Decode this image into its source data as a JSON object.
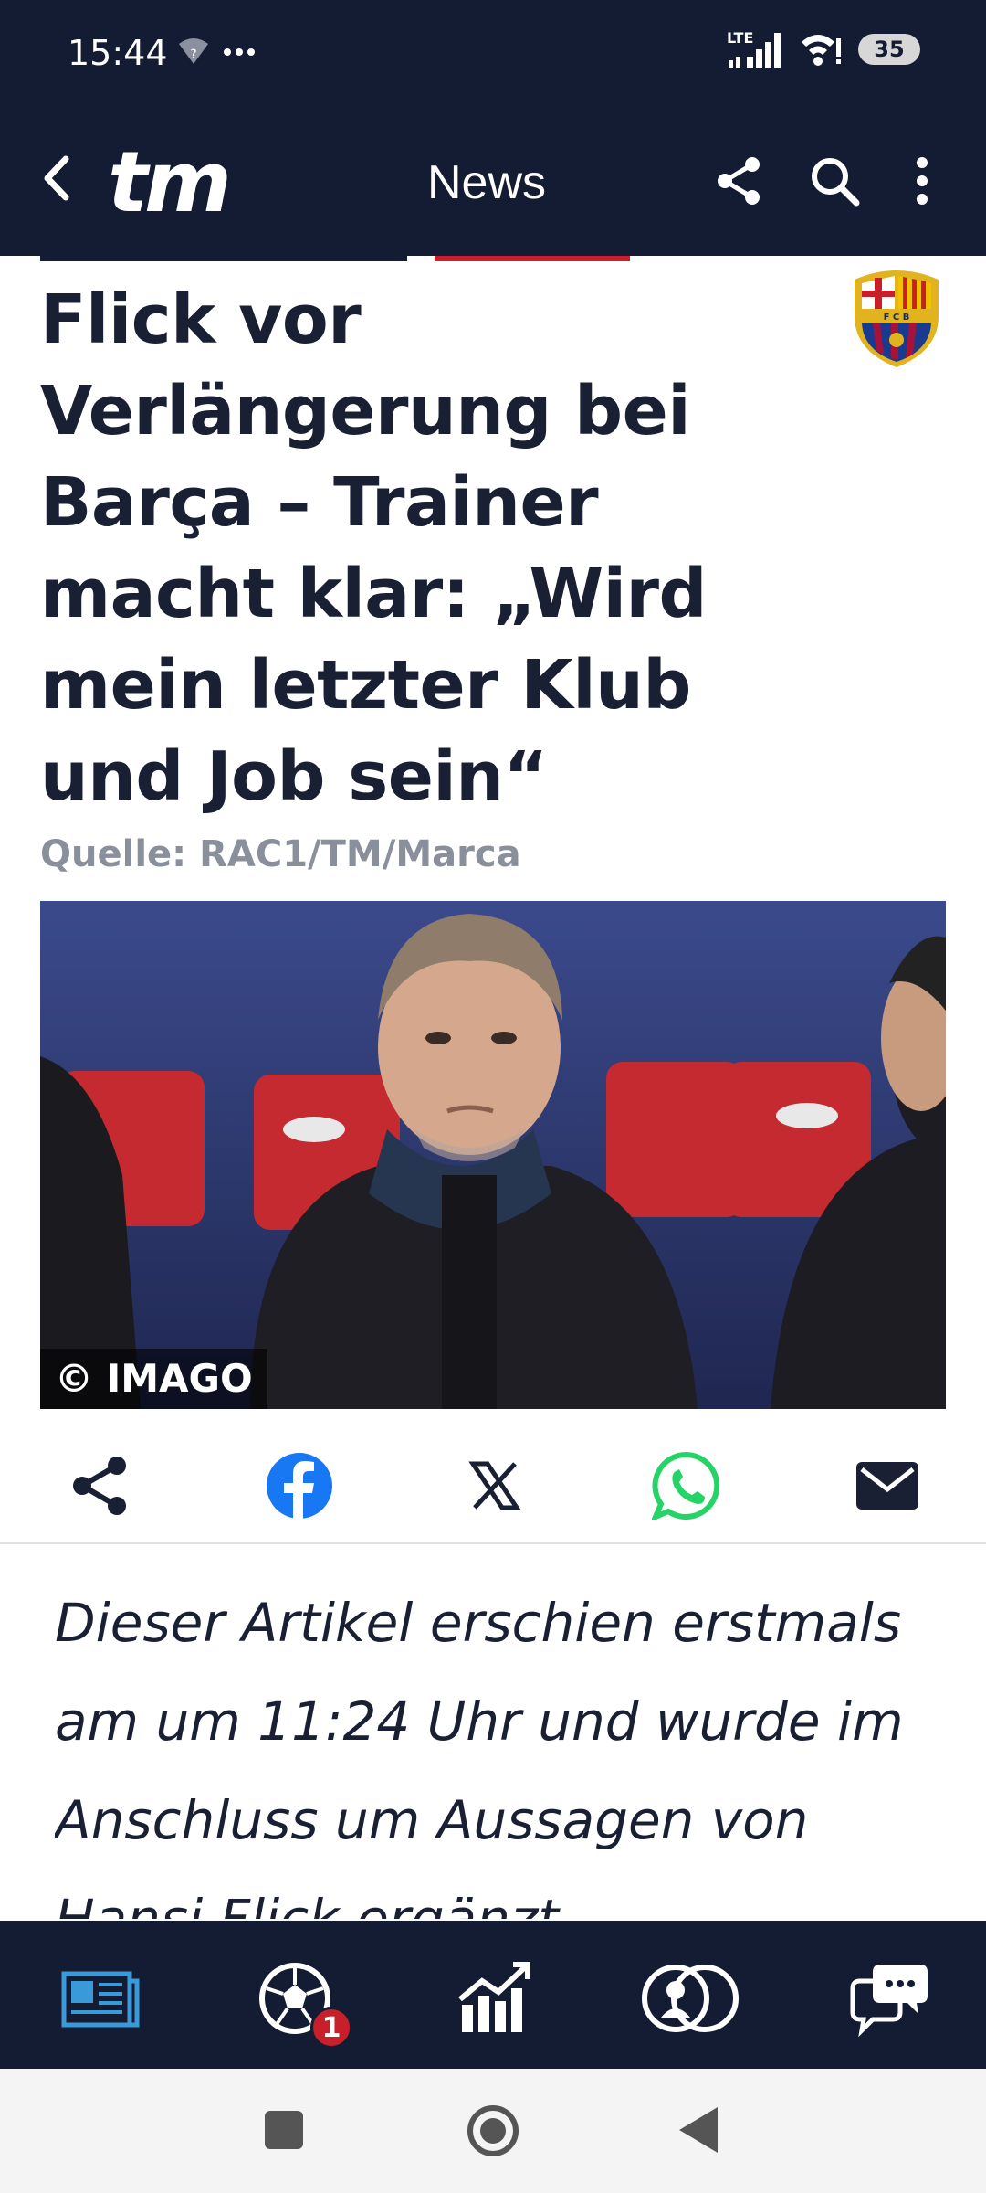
{
  "status_bar": {
    "time": "15:44",
    "network": "LTE",
    "battery": "35"
  },
  "app_bar": {
    "logo": "tm",
    "title": "News"
  },
  "article": {
    "headline": "Flick vor Verlängerung bei Barça – Trainer macht klar: „Wird mein letzter Klub und Job sein“",
    "source": "Quelle: RAC1/TM/Marca",
    "image_credit": "© IMAGO",
    "lead": "Dieser Artikel erschien erstmals am um 11:24 Uhr und wurde im Anschluss um Aussagen von Hansi Flick ergänzt."
  },
  "share": {
    "icons": [
      "share-icon",
      "facebook-icon",
      "x-icon",
      "whatsapp-icon",
      "mail-icon"
    ]
  },
  "bottom_nav": {
    "items": [
      "news-icon",
      "football-icon",
      "market-value-icon",
      "transfers-icon",
      "chat-icon"
    ],
    "badge_count": "1"
  },
  "colors": {
    "navy": "#141c33",
    "accent_red": "#c8202b",
    "facebook": "#1877f2",
    "whatsapp": "#25d366",
    "active_nav": "#3a9ad9"
  }
}
